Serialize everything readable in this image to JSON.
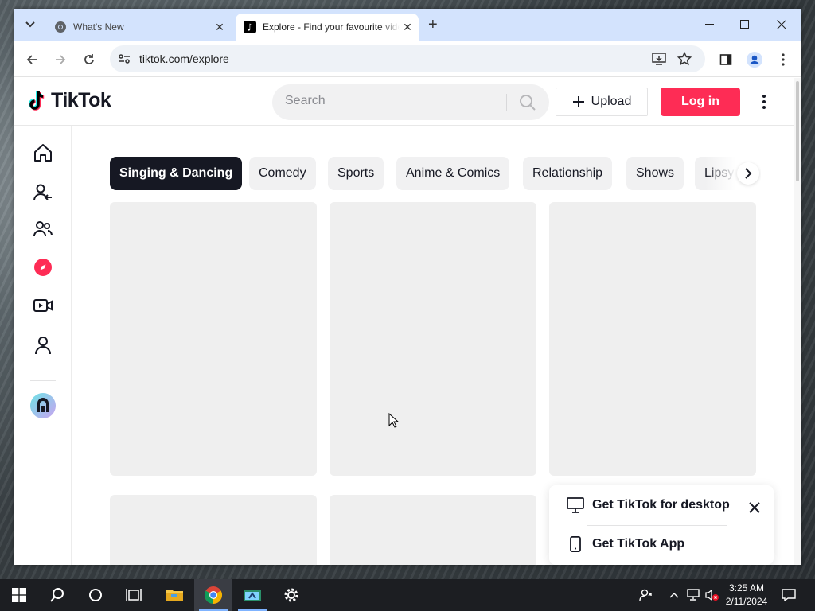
{
  "browser": {
    "tabs": [
      {
        "title": "What's New",
        "active": false
      },
      {
        "title": "Explore - Find your favourite videos on TikTok",
        "active": true
      }
    ],
    "url": "tiktok.com/explore"
  },
  "tiktok": {
    "logo_text": "TikTok",
    "search_placeholder": "Search",
    "upload_label": "Upload",
    "login_label": "Log in",
    "sidebar_icons": [
      "home-icon",
      "following-icon",
      "friends-icon",
      "explore-icon",
      "live-icon",
      "profile-icon",
      "avatar"
    ],
    "categories": [
      "Singing & Dancing",
      "Comedy",
      "Sports",
      "Anime & Comics",
      "Relationship",
      "Shows",
      "Lipsync"
    ],
    "active_category": "Singing & Dancing",
    "promo": {
      "desktop_label": "Get TikTok for desktop",
      "app_label": "Get TikTok App"
    }
  },
  "taskbar": {
    "time": "3:25 AM",
    "date": "2/11/2024"
  },
  "colors": {
    "tiktok_red": "#fe2c55",
    "tab_strip": "#d3e3fd",
    "active_chip": "#161823"
  }
}
